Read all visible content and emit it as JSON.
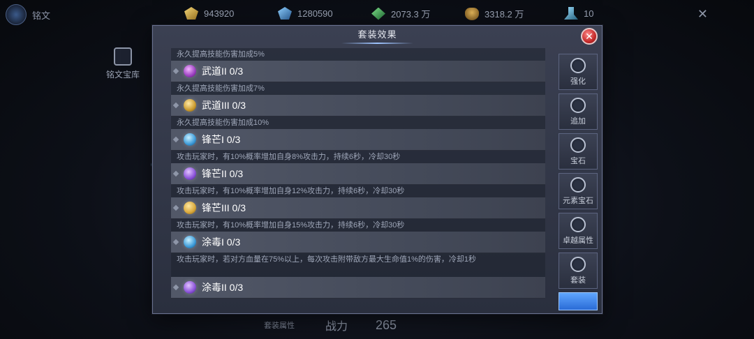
{
  "topbar": {
    "title": "铭文",
    "resources": [
      {
        "icon": "gold-gem-icon",
        "value": "943920"
      },
      {
        "icon": "blue-gem-icon",
        "value": "1280590"
      },
      {
        "icon": "leaf-icon",
        "value": "2073.3 万"
      },
      {
        "icon": "money-bag-icon",
        "value": "3318.2 万"
      },
      {
        "icon": "key-icon",
        "value": "10"
      }
    ]
  },
  "side": {
    "vault_label": "铭文宝库"
  },
  "dialog": {
    "title": "套装效果",
    "close": "✕",
    "rows": [
      {
        "desc": "永久提高技能伤害加成5%",
        "name": "武道II 0/3",
        "gem": "gem-purple"
      },
      {
        "desc": "永久提高技能伤害加成7%",
        "name": "武道III 0/3",
        "gem": "gem-gold"
      },
      {
        "desc": "永久提高技能伤害加成10%",
        "name": "锋芒I 0/3",
        "gem": "gem-blue"
      },
      {
        "desc": "攻击玩家时，有10%概率增加自身8%攻击力，持续6秒，冷却30秒",
        "name": "锋芒II 0/3",
        "gem": "gem-violet"
      },
      {
        "desc": "攻击玩家时，有10%概率增加自身12%攻击力，持续6秒，冷却30秒",
        "name": "锋芒III 0/3",
        "gem": "gem-amber"
      },
      {
        "desc": "攻击玩家时，有10%概率增加自身15%攻击力，持续6秒，冷却30秒",
        "name": "涂毒I 0/3",
        "gem": "gem-blue"
      },
      {
        "desc": "攻击玩家时，若对方血量在75%以上，每次攻击附带敌方最大生命值1%的伤害，冷却1秒",
        "name": "涂毒II 0/3",
        "gem": "gem-violet"
      }
    ],
    "tabs": [
      {
        "label": "强化",
        "icon": "anvil-icon"
      },
      {
        "label": "追加",
        "icon": "plus-circle-icon"
      },
      {
        "label": "宝石",
        "icon": "gem-socket-icon"
      },
      {
        "label": "元素宝石",
        "icon": "element-gem-icon"
      },
      {
        "label": "卓越属性",
        "icon": "sword-icon"
      },
      {
        "label": "套装",
        "icon": "wing-emblem-icon"
      }
    ]
  },
  "bottom": {
    "set_attr_label": "套装属性",
    "power_label": "战力",
    "power_value": "265"
  }
}
